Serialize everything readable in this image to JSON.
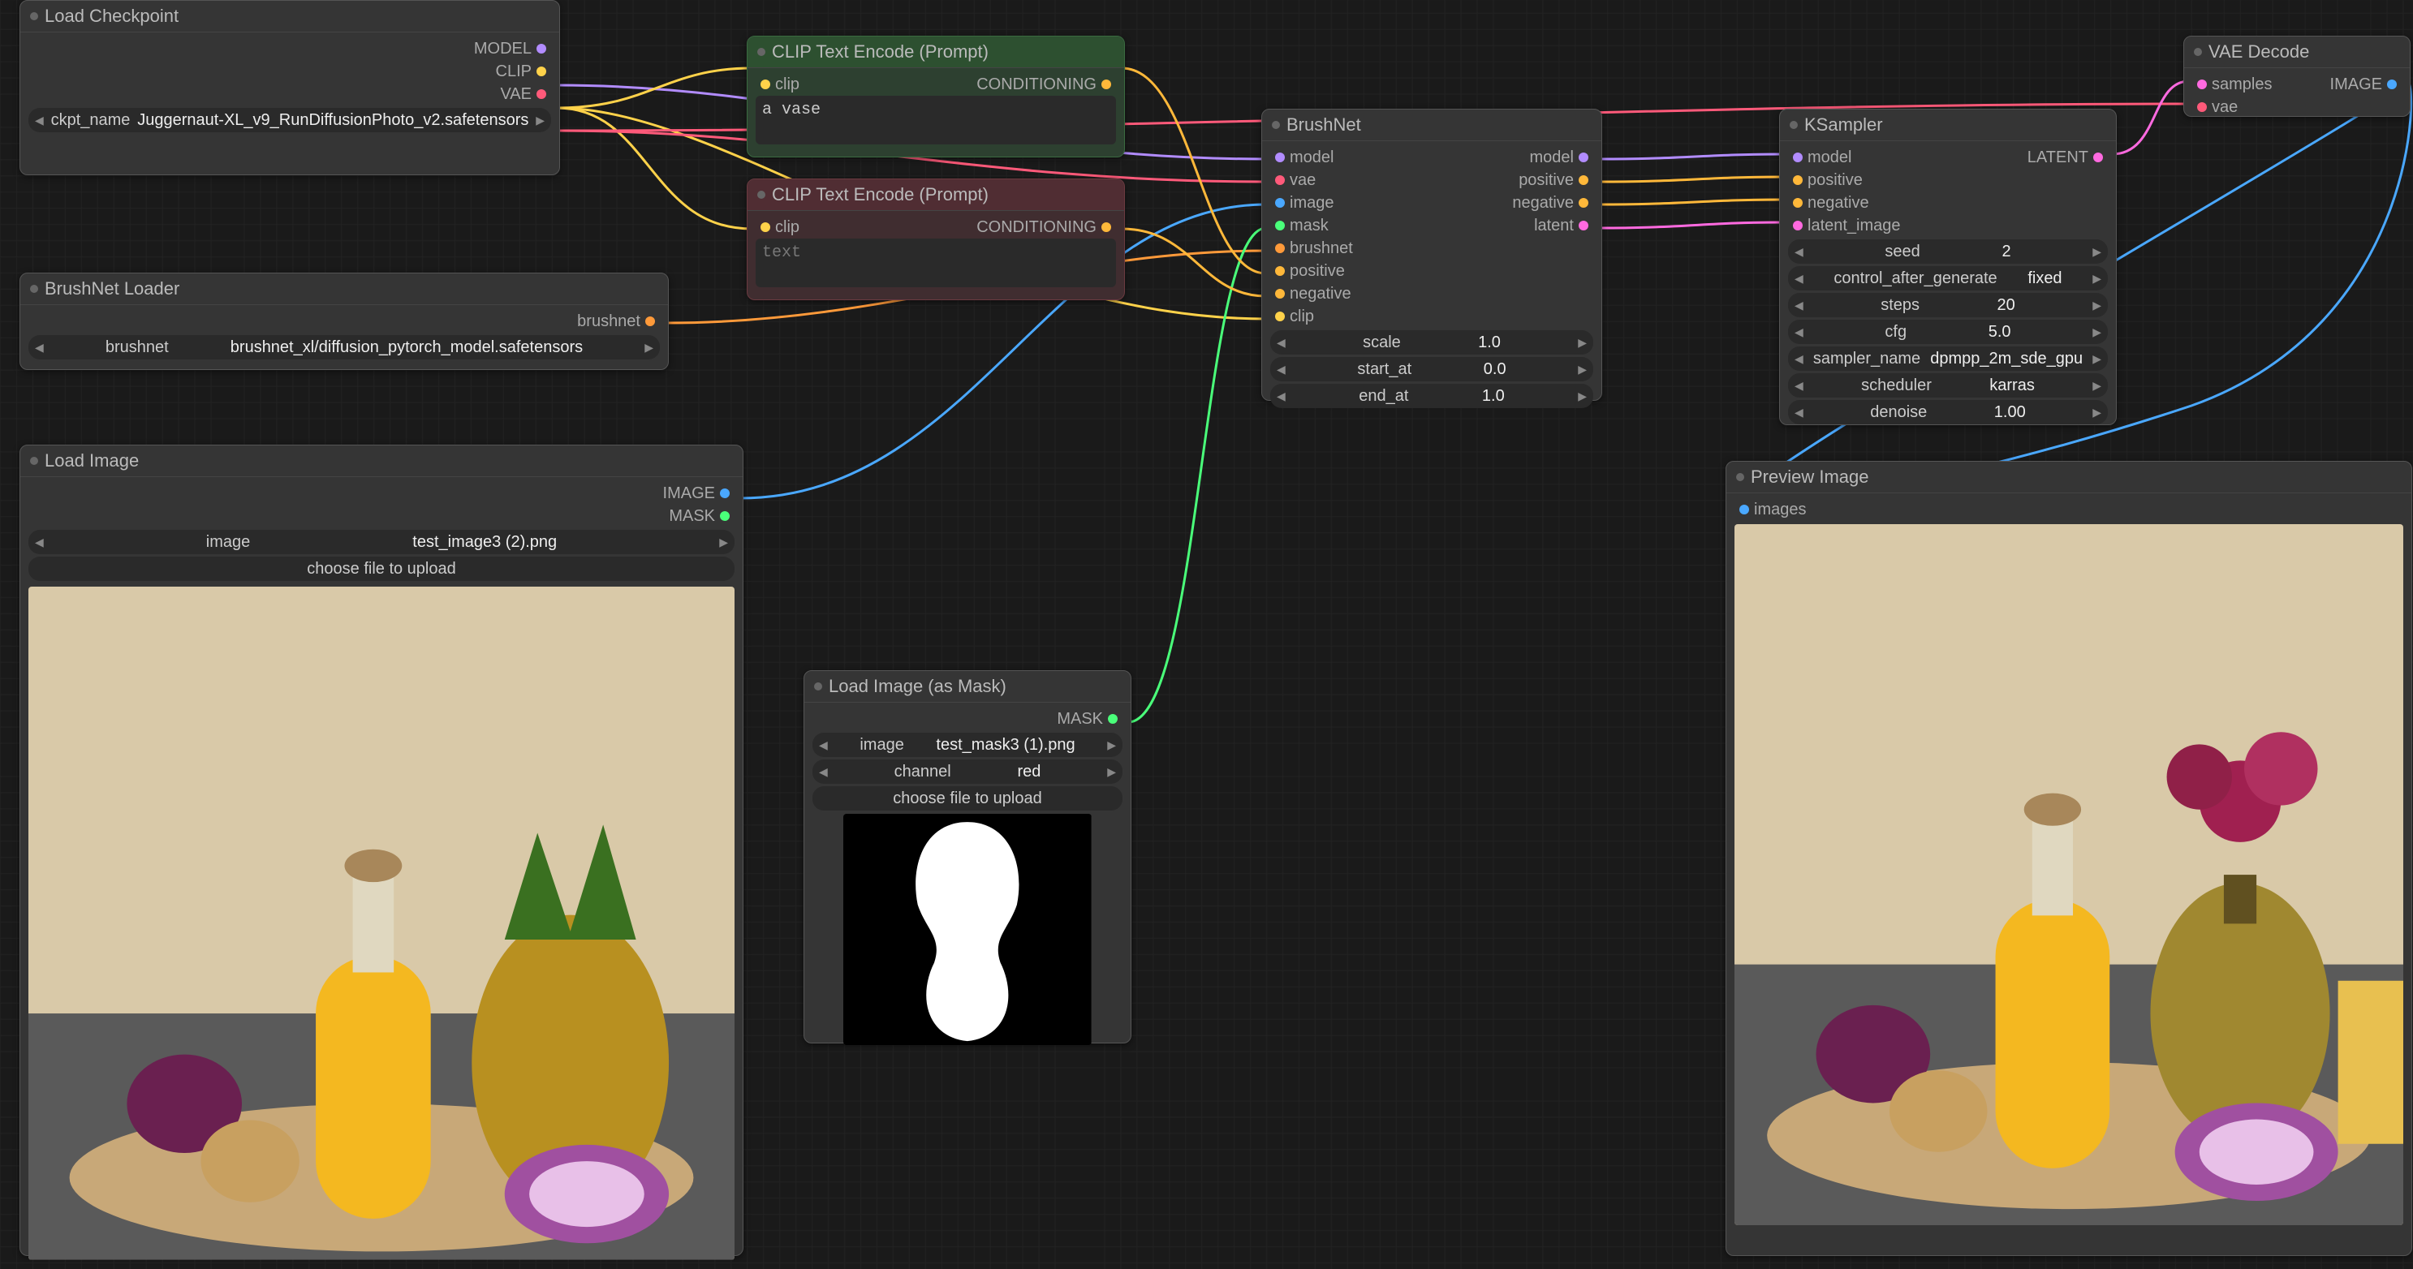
{
  "nodes": {
    "load_checkpoint": {
      "title": "Load Checkpoint",
      "ckpt_label": "ckpt_name",
      "ckpt_value": "Juggernaut-XL_v9_RunDiffusionPhoto_v2.safetensors",
      "out_model": "MODEL",
      "out_clip": "CLIP",
      "out_vae": "VAE"
    },
    "brushnet_loader": {
      "title": "BrushNet Loader",
      "out_brushnet": "brushnet",
      "brushnet_label": "brushnet",
      "brushnet_value": "brushnet_xl/diffusion_pytorch_model.safetensors"
    },
    "load_image": {
      "title": "Load Image",
      "out_image": "IMAGE",
      "out_mask": "MASK",
      "image_label": "image",
      "image_value": "test_image3 (2).png",
      "upload_btn": "choose file to upload"
    },
    "clip_pos": {
      "title": "CLIP Text Encode (Prompt)",
      "in_clip": "clip",
      "out_cond": "CONDITIONING",
      "text": "a vase"
    },
    "clip_neg": {
      "title": "CLIP Text Encode (Prompt)",
      "in_clip": "clip",
      "out_cond": "CONDITIONING",
      "placeholder": "text"
    },
    "load_mask": {
      "title": "Load Image (as Mask)",
      "out_mask": "MASK",
      "image_label": "image",
      "image_value": "test_mask3 (1).png",
      "channel_label": "channel",
      "channel_value": "red",
      "upload_btn": "choose file to upload"
    },
    "brushnet": {
      "title": "BrushNet",
      "in": [
        "model",
        "vae",
        "image",
        "mask",
        "brushnet",
        "positive",
        "negative",
        "clip"
      ],
      "out": [
        "model",
        "positive",
        "negative",
        "latent"
      ],
      "scale_label": "scale",
      "scale_value": "1.0",
      "start_label": "start_at",
      "start_value": "0.0",
      "end_label": "end_at",
      "end_value": "1.0"
    },
    "ksampler": {
      "title": "KSampler",
      "in": [
        "model",
        "positive",
        "negative",
        "latent_image"
      ],
      "out_latent": "LATENT",
      "seed_label": "seed",
      "seed_value": "2",
      "cag_label": "control_after_generate",
      "cag_value": "fixed",
      "steps_label": "steps",
      "steps_value": "20",
      "cfg_label": "cfg",
      "cfg_value": "5.0",
      "sampler_label": "sampler_name",
      "sampler_value": "dpmpp_2m_sde_gpu",
      "sched_label": "scheduler",
      "sched_value": "karras",
      "denoise_label": "denoise",
      "denoise_value": "1.00"
    },
    "vae_decode": {
      "title": "VAE Decode",
      "in_samples": "samples",
      "in_vae": "vae",
      "out_image": "IMAGE"
    },
    "preview": {
      "title": "Preview Image",
      "in_images": "images"
    }
  },
  "colors": {
    "model": "#b28cff",
    "clip": "#ffd24a",
    "vae": "#ff5a7a",
    "image": "#4aa8ff",
    "mask": "#4aff7a",
    "brushnet": "#ff9a3a",
    "cond": "#ffb83a",
    "cond_alt": "#ff6ae0",
    "latent": "#ff6ae0"
  }
}
